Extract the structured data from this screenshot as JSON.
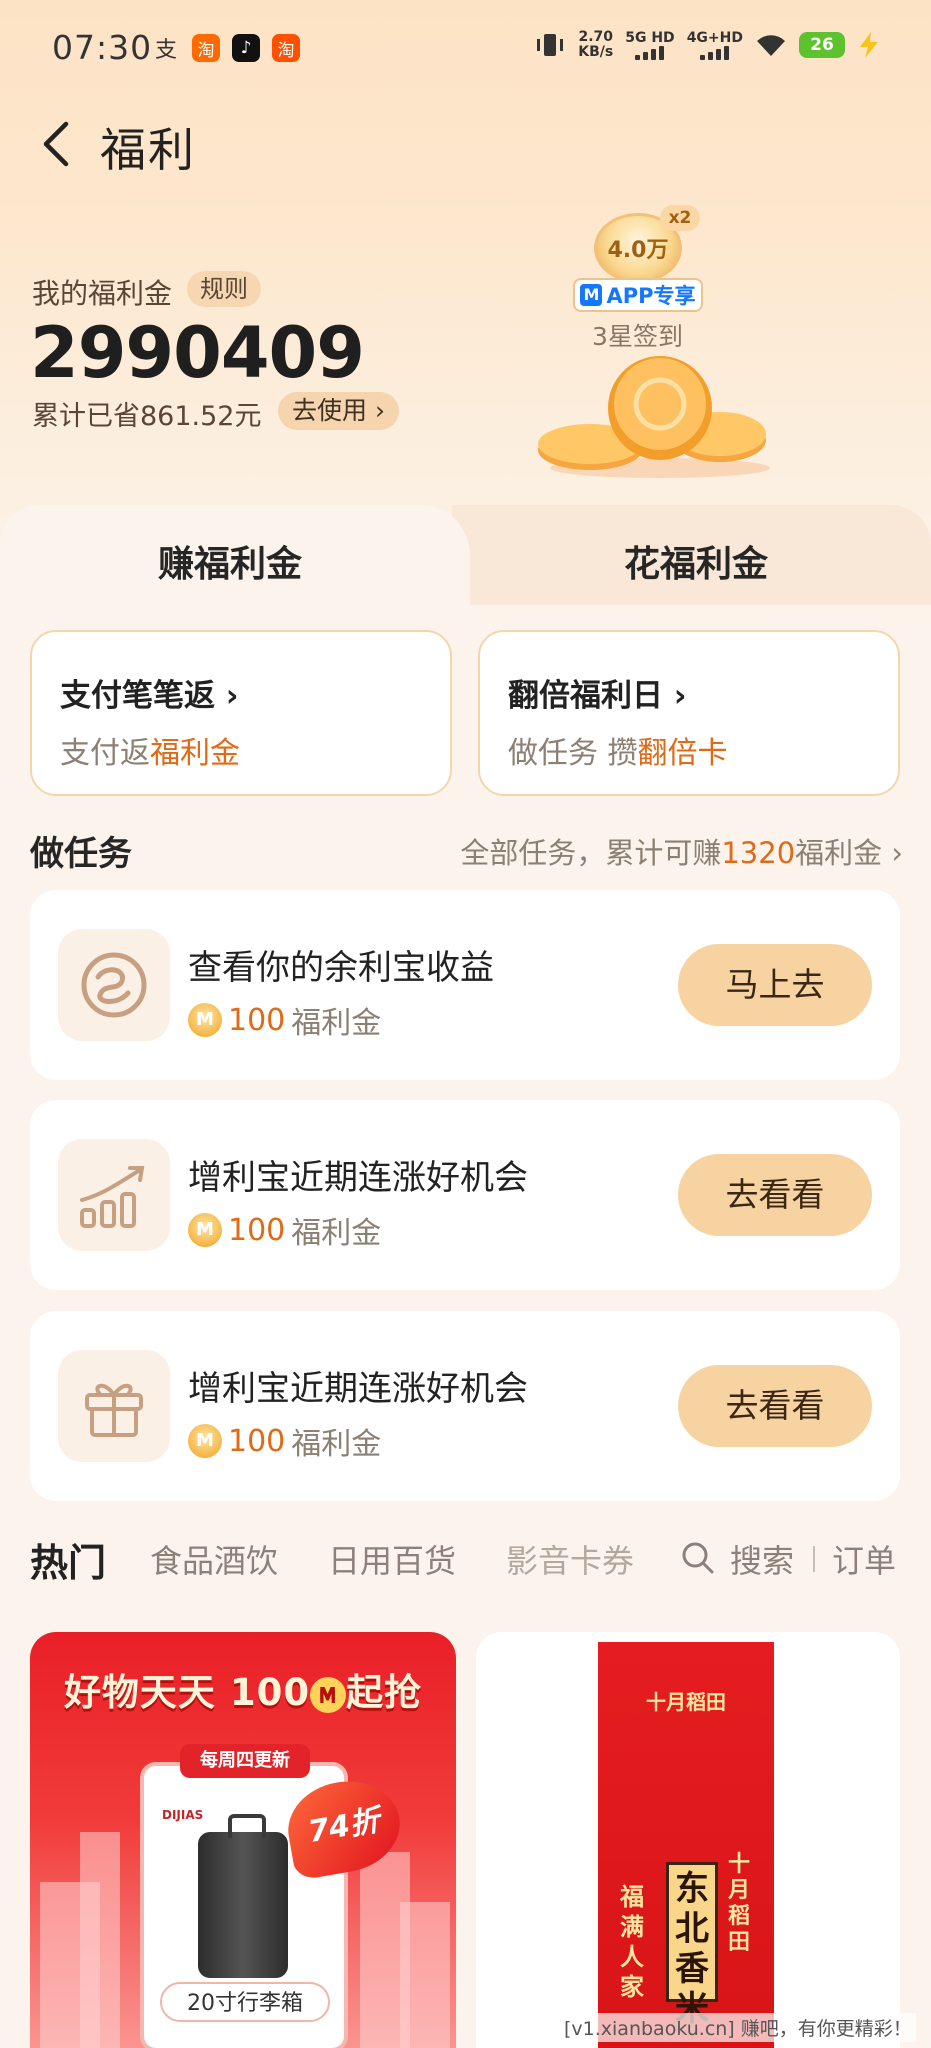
{
  "status_bar": {
    "time": "07:30",
    "net_speed": "2.70",
    "net_unit": "KB/s",
    "sim1": "5G HD",
    "sim2": "4G+HD",
    "battery": "26",
    "apps": [
      {
        "icon": "alipay-icon",
        "glyph": "支",
        "color": "#ffffff00"
      },
      {
        "icon": "taobao-shop-icon",
        "glyph": "淘",
        "color": "#ff6a00"
      },
      {
        "icon": "tiktok-icon",
        "glyph": "♪",
        "color": "#111111"
      },
      {
        "icon": "taobao-icon",
        "glyph": "淘",
        "color": "#ff5000"
      }
    ]
  },
  "header": {
    "title": "福利"
  },
  "balance": {
    "label": "我的福利金",
    "rules": "规则",
    "amount": "2990409",
    "saved": "累计已省861.52元",
    "use_label": "去使用"
  },
  "checkin": {
    "coin_value": "4.0万",
    "multiplier": "x2",
    "app_badge": "APP专享",
    "label": "3星签到"
  },
  "tabs": [
    {
      "label": "赚福利金",
      "active": true
    },
    {
      "label": "花福利金",
      "active": false
    }
  ],
  "promo_cards": [
    {
      "title": "支付笔笔返",
      "sub_prefix": "支付返",
      "sub_highlight": "福利金"
    },
    {
      "title": "翻倍福利日",
      "sub_prefix": "做任务 攒",
      "sub_highlight": "翻倍卡"
    }
  ],
  "tasks_section": {
    "title": "做任务",
    "summary_prefix": "全部任务，累计可赚",
    "summary_amount": "1320",
    "summary_suffix": "福利金"
  },
  "tasks": [
    {
      "icon": "yulibao-icon",
      "title": "查看你的余利宝收益",
      "reward_amount": "100",
      "reward_unit": "福利金",
      "button": "马上去"
    },
    {
      "icon": "growth-chart-icon",
      "title": "增利宝近期连涨好机会",
      "reward_amount": "100",
      "reward_unit": "福利金",
      "button": "去看看"
    },
    {
      "icon": "gift-icon",
      "title": "增利宝近期连涨好机会",
      "reward_amount": "100",
      "reward_unit": "福利金",
      "button": "去看看"
    }
  ],
  "categories": {
    "items": [
      "热门",
      "食品酒饮",
      "日用百货",
      "影音卡券"
    ],
    "search": "搜索",
    "orders": "订单"
  },
  "products": {
    "left": {
      "banner_prefix": "好物天天",
      "banner_amount": "100",
      "banner_suffix": "起抢",
      "weekly": "每周四更新",
      "discount": "74折",
      "brand": "DIJIAS",
      "caption": "20寸行李箱"
    },
    "right": {
      "brand_top": "十月稻田",
      "brand_vertical": "十月稻田",
      "name": "东北香米",
      "slogan": "福满人家"
    }
  },
  "watermark": "[v1.xianbaoku.cn] 赚吧，有你更精彩！"
}
